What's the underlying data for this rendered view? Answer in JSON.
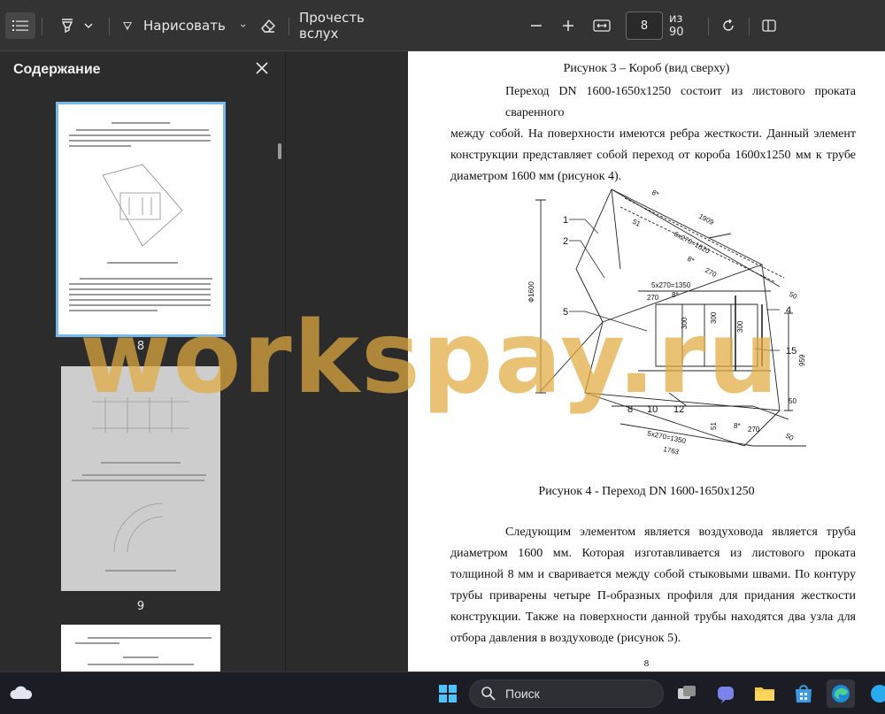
{
  "toolbar": {
    "draw_label": "Нарисовать",
    "read_aloud_label": "Прочесть вслух",
    "page_current": "8",
    "page_total": "из 90"
  },
  "sidebar": {
    "title": "Содержание",
    "thumbnails": [
      {
        "label": "8"
      },
      {
        "label": "9"
      }
    ]
  },
  "document": {
    "caption_fig3": "Рисунок 3 – Короб (вид сверху)",
    "para1_lines": [
      "Переход DN 1600-1650х1250 состоит из листового проката сваренного",
      "между собой. На поверхности имеются ребра жесткости. Данный элемент",
      "конструкции представляет собой переход от короба 1600х1250 мм к трубе",
      "диаметром 1600 мм (рисунок 4)."
    ],
    "caption_fig4": "Рисунок 4 - Переход DN 1600-1650х1250",
    "para2_lines": [
      "Следующим элементом является воздуховода является труба",
      "диаметром 1600 мм. Которая изготавливается из листового проката",
      "толщиной 8 мм и сваривается между собой стыковыми швами. По контуру",
      "трубы приварены четыре П-образных профиля для придания жесткости",
      "конструкции. Также на поверхности данной трубы находятся два узла для",
      "отбора давления в воздуховоде (рисунок 5)."
    ],
    "page_number": "8",
    "drawing": {
      "dims": [
        "1909",
        "6х270=1620",
        "50",
        "8*",
        "270",
        "5х270=1350",
        "270",
        "8*",
        "300",
        "300",
        "300",
        "Ф1600",
        "959",
        "50",
        "5х270=1350",
        "1763",
        "270",
        "50",
        "8*",
        "8*",
        "51",
        "51"
      ],
      "callouts": [
        "1",
        "2",
        "5",
        "4",
        "15",
        "8",
        "10",
        "12"
      ]
    }
  },
  "watermark": "workspay.ru",
  "taskbar": {
    "search_label": "Поиск"
  },
  "colors": {
    "accent": "#76b9ed",
    "watermark": "#e2aa40"
  }
}
